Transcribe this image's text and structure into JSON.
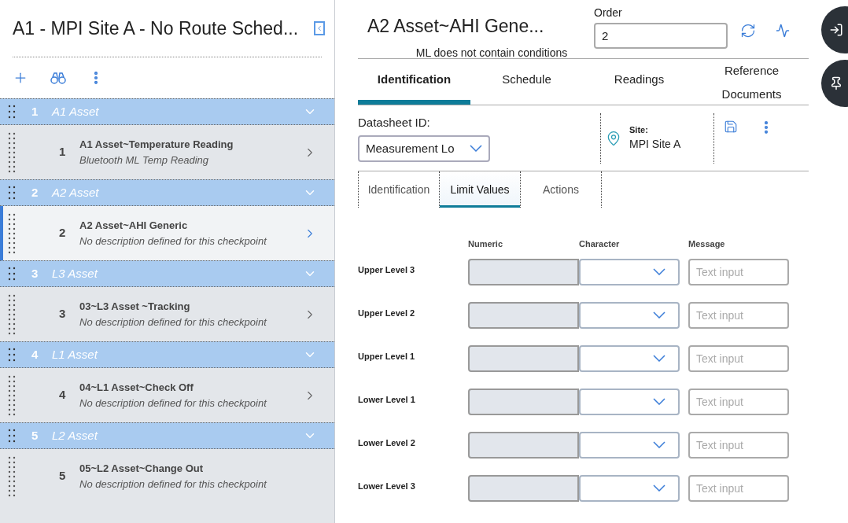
{
  "left_panel": {
    "title": "A1 - MPI Site A - No Route Sched...",
    "groups": [
      {
        "number": "1",
        "name": "A1 Asset",
        "expanded": true,
        "checkpoints": [
          {
            "number": "1",
            "title": "A1 Asset~Temperature Reading",
            "description": "Bluetooth ML Temp Reading",
            "selected": false,
            "has_chevron": true
          }
        ]
      },
      {
        "number": "2",
        "name": "A2 Asset",
        "expanded": true,
        "checkpoints": [
          {
            "number": "2",
            "title": "A2 Asset~AHI Generic",
            "description": "No description defined for this checkpoint",
            "selected": true,
            "has_chevron": true
          }
        ]
      },
      {
        "number": "3",
        "name": "L3 Asset",
        "expanded": true,
        "checkpoints": [
          {
            "number": "3",
            "title": "03~L3 Asset ~Tracking",
            "description": "No description defined for this checkpoint",
            "selected": false,
            "has_chevron": true
          }
        ]
      },
      {
        "number": "4",
        "name": "L1 Asset",
        "expanded": true,
        "checkpoints": [
          {
            "number": "4",
            "title": "04~L1 Asset~Check Off",
            "description": "No description defined for this checkpoint",
            "selected": false,
            "has_chevron": true
          }
        ]
      },
      {
        "number": "5",
        "name": "L2 Asset",
        "expanded": true,
        "checkpoints": [
          {
            "number": "5",
            "title": "05~L2 Asset~Change Out",
            "description": "No description defined for this checkpoint",
            "selected": false,
            "has_chevron": false
          }
        ]
      }
    ]
  },
  "detail": {
    "title": "A2 Asset~AHI Gene...",
    "subtitle": "ML does not contain conditions",
    "order": {
      "label": "Order",
      "value": "2"
    },
    "tabs": [
      {
        "label": "Identification",
        "selected": true
      },
      {
        "label": "Schedule",
        "selected": false
      },
      {
        "label": "Readings",
        "selected": false
      },
      {
        "label": "Reference Documents",
        "selected": false
      }
    ],
    "datasheet": {
      "label": "Datasheet ID:",
      "value": "Measurement Lo"
    },
    "site": {
      "label": "Site:",
      "value": "MPI Site A"
    },
    "sub_tabs": [
      {
        "label": "Identification",
        "selected": false
      },
      {
        "label": "Limit Values",
        "selected": true
      },
      {
        "label": "Actions",
        "selected": false
      }
    ],
    "limits": {
      "columns": [
        "Numeric",
        "Character",
        "Message"
      ],
      "rows": [
        {
          "label": "Upper Level 3",
          "placeholder": "Text input"
        },
        {
          "label": "Upper Level 2",
          "placeholder": "Text input"
        },
        {
          "label": "Upper Level 1",
          "placeholder": "Text input"
        },
        {
          "label": "Lower Level 1",
          "placeholder": "Text input"
        },
        {
          "label": "Lower Level 2",
          "placeholder": "Text input"
        },
        {
          "label": "Lower Level 3",
          "placeholder": "Text input"
        }
      ]
    }
  }
}
